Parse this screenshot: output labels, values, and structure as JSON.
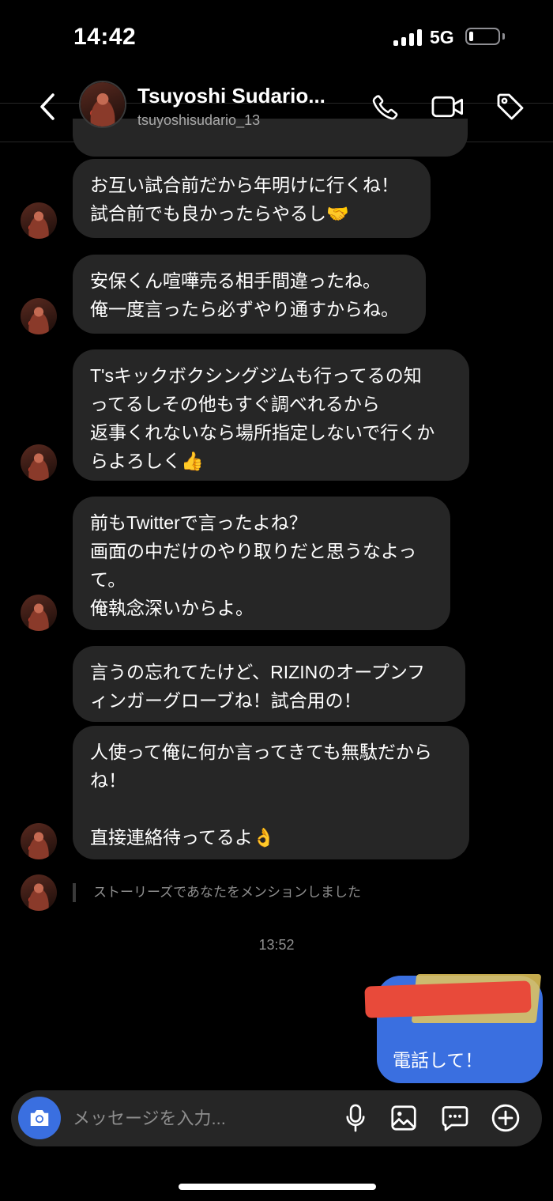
{
  "status_bar": {
    "time": "14:42",
    "network": "5G",
    "battery_level": 0.15
  },
  "header": {
    "display_name": "Tsuyoshi Sudario...",
    "username": "tsuyoshisudario_13",
    "icons": [
      "back-icon",
      "phone-icon",
      "video-icon",
      "tag-icon"
    ]
  },
  "messages": [
    {
      "text": "お互い試合前だから年明けに行くね！\n試合前でも良かったらやるし🤝"
    },
    {
      "text": "安保くん喧嘩売る相手間違ったね。\n俺一度言ったら必ずやり通すからね。"
    },
    {
      "text": "T'sキックボクシングジムも行ってるの知\nってるしその他もすぐ調べれるから\n返事くれないなら場所指定しないで行くか\nらよろしく👍"
    },
    {
      "text": "前もTwitterで言ったよね？\n画面の中だけのやり取りだと思うなよっ\nて。\n俺執念深いからよ。"
    },
    {
      "text": "言うの忘れてたけど、RIZINのオープンフ\nィンガーグローブね！試合用の！"
    },
    {
      "text": "人使って俺に何か言ってきても無駄だから\nね！\n\n直接連絡待ってるよ👌"
    }
  ],
  "mention_text": "ストーリーズであなたをメンションしました",
  "timestamp": "13:52",
  "outgoing": {
    "text": "電話して！"
  },
  "composer": {
    "placeholder": "メッセージを入力..."
  }
}
